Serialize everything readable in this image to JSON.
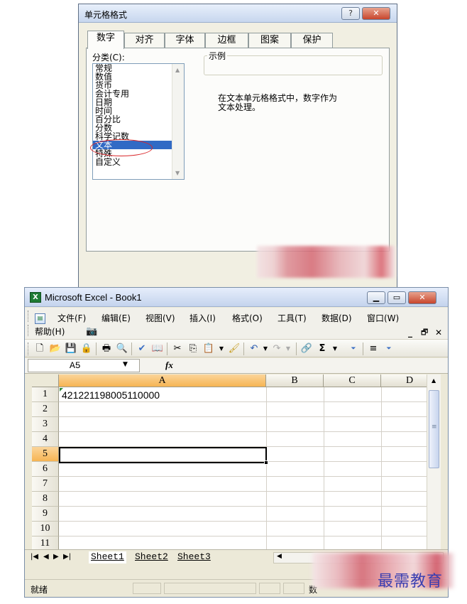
{
  "dialog": {
    "title": "单元格格式",
    "help_label": "?",
    "close_label": "✕",
    "tabs": [
      "数字",
      "对齐",
      "字体",
      "边框",
      "图案",
      "保护"
    ],
    "category_label": "分类(C):",
    "categories": [
      "常规",
      "数值",
      "货币",
      "会计专用",
      "日期",
      "时间",
      "百分比",
      "分数",
      "科学记数",
      "文本",
      "特殊",
      "自定义"
    ],
    "selected_category": "文本",
    "sample_label": "示例",
    "description_line1": "在文本单元格格式中，数字作为",
    "description_line2": "文本处理。"
  },
  "excel": {
    "title": "Microsoft Excel - Book1",
    "menu": [
      "文件(F)",
      "编辑(E)",
      "视图(V)",
      "插入(I)",
      "格式(O)",
      "工具(T)",
      "数据(D)",
      "窗口(W)",
      "帮助(H)"
    ],
    "doc_controls": [
      "_",
      "♂",
      "✕"
    ],
    "name_box": "A5",
    "fx_label": "fx",
    "columns": [
      "A",
      "B",
      "C",
      "D"
    ],
    "rows": [
      "1",
      "2",
      "3",
      "4",
      "5",
      "6",
      "7",
      "8",
      "9",
      "10",
      "11"
    ],
    "cell_a1": "421221198005110000",
    "active_column": "A",
    "active_row": "5",
    "sheets": [
      "Sheet1",
      "Sheet2",
      "Sheet3"
    ],
    "status": "就绪",
    "status_partial": "数"
  },
  "watermark": "最需教育",
  "colors": {
    "selection": "#316ac5",
    "highlight_ellipse": "#d9262a",
    "header_active": "#f6b453"
  }
}
